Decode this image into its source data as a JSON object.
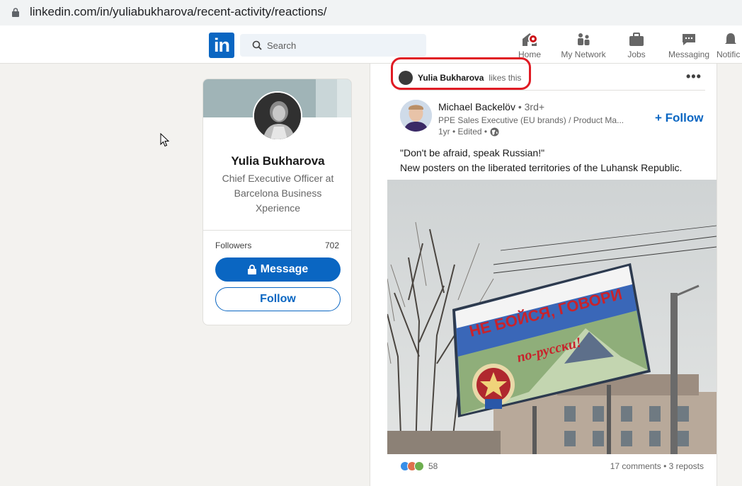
{
  "browser": {
    "url": "linkedin.com/in/yuliabukharova/recent-activity/reactions/"
  },
  "nav": {
    "logo": "in",
    "search_placeholder": "Search",
    "items": [
      {
        "label": "Home",
        "icon": "home-icon"
      },
      {
        "label": "My Network",
        "icon": "network-icon"
      },
      {
        "label": "Jobs",
        "icon": "briefcase-icon"
      },
      {
        "label": "Messaging",
        "icon": "messaging-icon"
      },
      {
        "label": "Notific",
        "icon": "bell-icon"
      }
    ]
  },
  "profile": {
    "name": "Yulia Bukharova",
    "headline": "Chief Executive Officer at Barcelona Business Xperience",
    "followers_label": "Followers",
    "followers_count": "702",
    "message_label": "Message",
    "follow_label": "Follow"
  },
  "post": {
    "activity_name": "Yulia Bukharova",
    "activity_action": "likes this",
    "author_name": "Michael Backelöv",
    "author_degree": "• 3rd+",
    "author_subtitle": "PPE Sales Executive (EU brands) / Product Ma...",
    "author_meta": "1yr • Edited •",
    "follow_label": "+ Follow",
    "text_line1": "\"Don't be afraid, speak Russian!\"",
    "text_line2": "New posters on the liberated territories of the Luhansk Republic.",
    "billboard_line1": "НЕ БОЙСЯ, ГОВОРИ",
    "billboard_line2": "по-русски!",
    "reaction_count": "58",
    "stats": "17 comments • 3 reposts"
  },
  "colors": {
    "brand": "#0a66c2",
    "highlight": "#e01b24",
    "badge": "#cc1016"
  }
}
